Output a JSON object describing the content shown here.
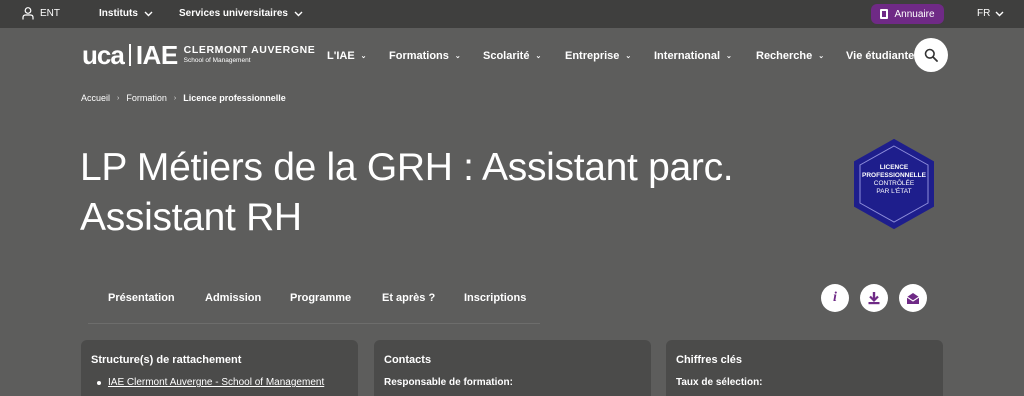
{
  "topbar": {
    "ent_label": "ENT",
    "menus": [
      {
        "label": "Instituts"
      },
      {
        "label": "Services universitaires"
      }
    ],
    "annuaire_label": "Annuaire",
    "lang_label": "FR"
  },
  "logo": {
    "mark": "uca",
    "iae": "IAE",
    "line1": "CLERMONT AUVERGNE",
    "line2": "School of Management"
  },
  "nav": [
    {
      "label": "L'IAE"
    },
    {
      "label": "Formations"
    },
    {
      "label": "Scolarité"
    },
    {
      "label": "Entreprise"
    },
    {
      "label": "International"
    },
    {
      "label": "Recherche"
    },
    {
      "label": "Vie étudiante"
    }
  ],
  "breadcrumb": [
    "Accueil",
    "Formation",
    "Licence professionnelle"
  ],
  "title_line1": "LP Métiers de la GRH : Assistant parc.",
  "title_line2": "Assistant RH",
  "badge": {
    "line1": "LICENCE",
    "line2": "PROFESSIONNELLE",
    "line3": "CONTRÔLÉE",
    "line4": "PAR L'ÉTAT"
  },
  "tabs": [
    "Présentation",
    "Admission",
    "Programme",
    "Et après ?",
    "Inscriptions"
  ],
  "cards": {
    "structures": {
      "title": "Structure(s) de rattachement",
      "items": [
        "IAE Clermont Auvergne - School of Management"
      ]
    },
    "contacts": {
      "title": "Contacts",
      "subtitle": "Responsable de formation:"
    },
    "chiffres": {
      "title": "Chiffres clés",
      "subtitle": "Taux de sélection:"
    }
  },
  "colors": {
    "page_bg": "#5d5d5c",
    "topbar_bg": "#3f3f3e",
    "accent_purple": "#6f2a86",
    "badge_blue": "#1e1e8c",
    "card_bg": "#4b4b4a"
  }
}
